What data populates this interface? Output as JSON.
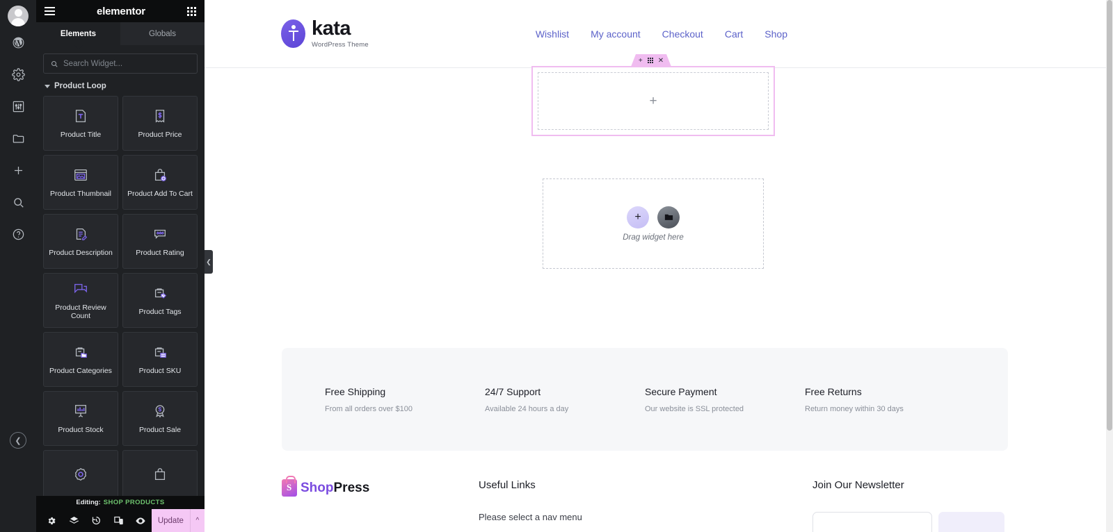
{
  "panel": {
    "logo": "elementor",
    "hamburger_icon": "hamburger-menu-icon",
    "apps_icon": "grid-apps-icon",
    "tabs": [
      {
        "label": "Elements",
        "active": true
      },
      {
        "label": "Globals",
        "active": false
      }
    ],
    "search": {
      "placeholder": "Search Widget...",
      "value": "",
      "icon": "search-icon"
    },
    "category": {
      "label": "Product Loop",
      "expanded": true
    },
    "widgets": [
      {
        "label": "Product Title",
        "icon": "text-title-icon"
      },
      {
        "label": "Product Price",
        "icon": "price-receipt-icon"
      },
      {
        "label": "Product Thumbnail",
        "icon": "image-thumbnail-icon"
      },
      {
        "label": "Product Add To Cart",
        "icon": "shopping-bag-plus-icon"
      },
      {
        "label": "Product Description",
        "icon": "document-edit-icon"
      },
      {
        "label": "Product Rating",
        "icon": "star-rating-icon"
      },
      {
        "label": "Product Review Count",
        "icon": "speech-bubbles-icon"
      },
      {
        "label": "Product Tags",
        "icon": "bag-tag-icon"
      },
      {
        "label": "Product Categories",
        "icon": "bag-folder-icon"
      },
      {
        "label": "Product SKU",
        "icon": "bag-barcode-icon"
      },
      {
        "label": "Product Stock",
        "icon": "chart-board-icon"
      },
      {
        "label": "Product Sale",
        "icon": "sale-badge-icon"
      },
      {
        "label": "",
        "icon": "gear-flower-icon"
      },
      {
        "label": "",
        "icon": "shopping-bag-icon"
      }
    ],
    "collapse_icon": "chevron-left-icon",
    "editing": {
      "prefix": "Editing:",
      "target": "SHOP PRODUCTS"
    },
    "footer": {
      "icons": [
        {
          "name": "settings-gear-icon"
        },
        {
          "name": "navigator-layers-icon"
        },
        {
          "name": "history-revision-icon"
        },
        {
          "name": "responsive-device-icon"
        },
        {
          "name": "preview-eye-icon"
        }
      ],
      "update_label": "Update",
      "update_caret_icon": "chevron-up-icon",
      "update_bg": "#f5c8f5"
    }
  },
  "rail": {
    "avatar_icon": "user-avatar-icon",
    "items": [
      {
        "icon": "wordpress-icon"
      },
      {
        "icon": "settings-gear-icon"
      },
      {
        "icon": "site-settings-sliders-icon"
      },
      {
        "icon": "folder-icon"
      },
      {
        "icon": "add-plus-icon"
      },
      {
        "icon": "search-icon"
      },
      {
        "icon": "help-question-icon"
      }
    ],
    "collapse_icon": "chevron-left-icon"
  },
  "site": {
    "brand": {
      "name": "kata",
      "tagline": "WordPress Theme",
      "logo_color": "#5b44d6"
    },
    "nav": [
      {
        "label": "Wishlist"
      },
      {
        "label": "My account"
      },
      {
        "label": "Checkout"
      },
      {
        "label": "Cart"
      },
      {
        "label": "Shop"
      }
    ],
    "nav_color": "#5c62c9",
    "selected_container": {
      "accent": "#f0bcf0",
      "add_icon": "plus-icon",
      "drag_icon": "drag-handle-dots-icon",
      "close_icon": "close-x-icon",
      "inner_add_icon": "plus-icon"
    },
    "drop_zone": {
      "label": "Drag widget here",
      "add_icon": "add-widget-plus-icon",
      "folder_icon": "template-folder-icon"
    },
    "features": [
      {
        "title": "Free Shipping",
        "desc": "From all orders over $100"
      },
      {
        "title": "24/7 Support",
        "desc": "Available 24 hours a day"
      },
      {
        "title": "Secure Payment",
        "desc": "Our website is SSL protected"
      },
      {
        "title": "Free Returns",
        "desc": "Return money within 30 days"
      }
    ],
    "footer": {
      "logo_prefix": "Shop",
      "logo_suffix": "Press",
      "links_title": "Useful Links",
      "links_note": "Please select a nav menu",
      "newsletter_title": "Join Our Newsletter"
    }
  }
}
